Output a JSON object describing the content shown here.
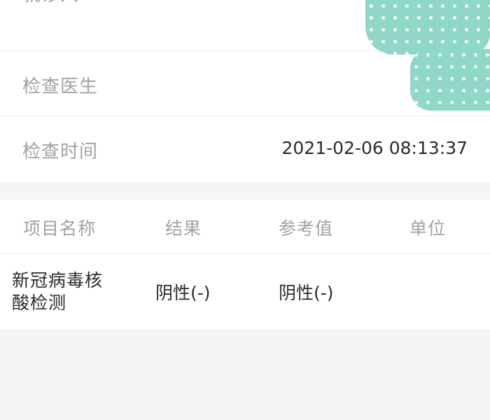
{
  "info": {
    "patient_label": "就诊人",
    "doctor_label": "检查医生",
    "time_label": "检查时间",
    "time_value": "2021-02-06 08:13:37"
  },
  "results_table": {
    "headers": [
      "项目名称",
      "结果",
      "参考值",
      "单位"
    ],
    "rows": [
      {
        "name": "新冠病毒核酸检测",
        "result": "阴性(-)",
        "reference": "阴性(-)",
        "unit": ""
      }
    ]
  },
  "colors": {
    "redaction": "#8fd8c8",
    "label_text": "#a2a2a2",
    "value_text": "#2b2b2b",
    "background": "#f5f5f5"
  }
}
